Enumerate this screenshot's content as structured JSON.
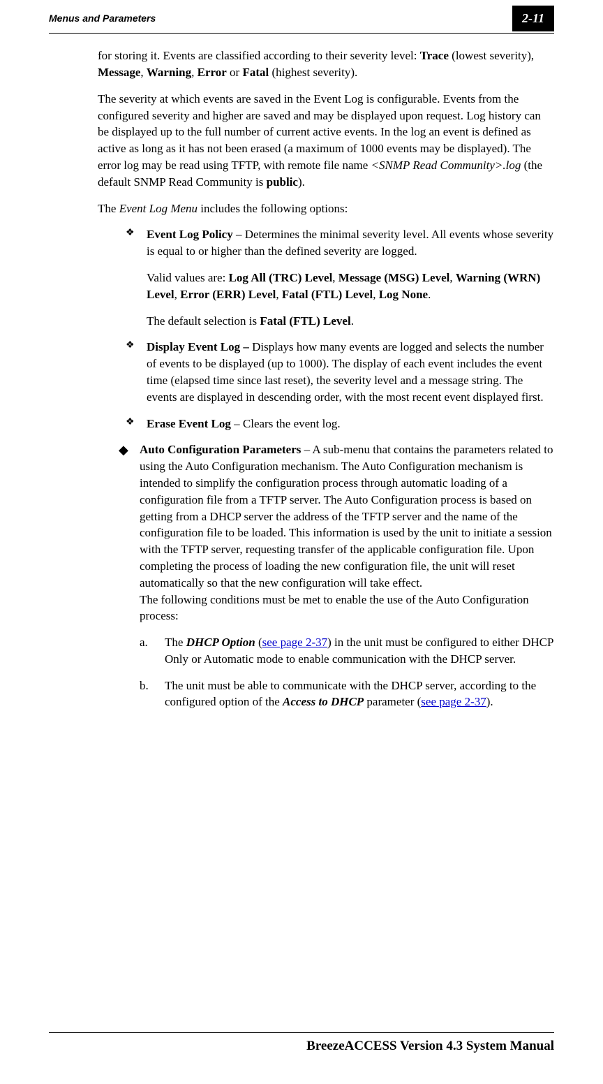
{
  "header": {
    "section": "Menus and Parameters",
    "page_number": "2-11"
  },
  "body": {
    "p1_a": "for storing it. Events are classified according to their severity level: ",
    "p1_trace": "Trace",
    "p1_b": " (lowest severity), ",
    "p1_message": "Message",
    "p1_c": ", ",
    "p1_warning": "Warning",
    "p1_d": ", ",
    "p1_error": "Error",
    "p1_e": " or ",
    "p1_fatal": "Fatal",
    "p1_f": " (highest severity).",
    "p2_a": "The severity at which events are saved in the Event Log is configurable. Events from the configured severity and higher are saved and may be displayed upon request. Log history can be displayed up to the full number of current active events. In the log an event is defined as active as long as it has not been erased (a maximum of 1000 events may be displayed). The error log may be read using TFTP, with remote file name ",
    "p2_b": "<SNMP Read Community>.log",
    "p2_c": " (the default SNMP Read Community is ",
    "p2_d": "public",
    "p2_e": ").",
    "p3_a": "The ",
    "p3_b": "Event Log Menu",
    "p3_c": " includes the following options:",
    "b1_title": "Event Log Policy",
    "b1_text": " – Determines the minimal severity level. All events whose severity is equal to or higher than the defined severity are logged.",
    "b1_s1_a": "Valid values are: ",
    "b1_s1_b": "Log All (TRC) Level",
    "b1_s1_c": ", ",
    "b1_s1_d": "Message (MSG) Level",
    "b1_s1_e": ", ",
    "b1_s1_f": "Warning (WRN) Level",
    "b1_s1_g": ", ",
    "b1_s1_h": "Error (ERR) Level",
    "b1_s1_i": ", ",
    "b1_s1_j": "Fatal (FTL) Level",
    "b1_s1_k": ", ",
    "b1_s1_l": "Log None",
    "b1_s1_m": ".",
    "b1_s2_a": "The default selection is ",
    "b1_s2_b": "Fatal (FTL) Level",
    "b1_s2_c": ".",
    "b2_title": "Display Event Log – ",
    "b2_text": "Displays how many events are logged and selects the number of events to be displayed (up to 1000). The display of each event includes the event time (elapsed time since last reset), the severity level and a message string. The events are displayed in descending order, with the most recent event displayed first.",
    "b3_title": "Erase Event Log",
    "b3_text": " – Clears the event log.",
    "d1_title": "Auto Configuration Parameters",
    "d1_text": " – A sub-menu that contains the parameters related to using the Auto Configuration mechanism. The Auto Configuration mechanism is intended to simplify the configuration process through automatic loading of a configuration file from a TFTP server. The Auto Configuration process is based on getting from a DHCP server the address of the TFTP server and the name of the configuration file to be loaded. This information is used by the unit to initiate a session with the TFTP server, requesting transfer of the applicable configuration file. Upon completing the process of loading the new configuration file, the unit will reset automatically so that the new configuration will take effect.",
    "d1_text2": "The following conditions must be met to enable the use of the Auto Configuration process:",
    "la_label": "a. ",
    "la_1": "The ",
    "la_2": "DHCP Option",
    "la_3": " (",
    "la_link": "see page 2-37",
    "la_4": ") in the unit must be configured to either DHCP Only or Automatic mode to enable communication with the DHCP server.",
    "lb_label": "b. ",
    "lb_1": "The unit must be able to communicate with the DHCP server, according to the configured option of the ",
    "lb_2": "Access to DHCP",
    "lb_3": " parameter (",
    "lb_link": "see page 2-37",
    "lb_4": ")."
  },
  "footer": {
    "text": "BreezeACCESS Version 4.3 System Manual"
  }
}
